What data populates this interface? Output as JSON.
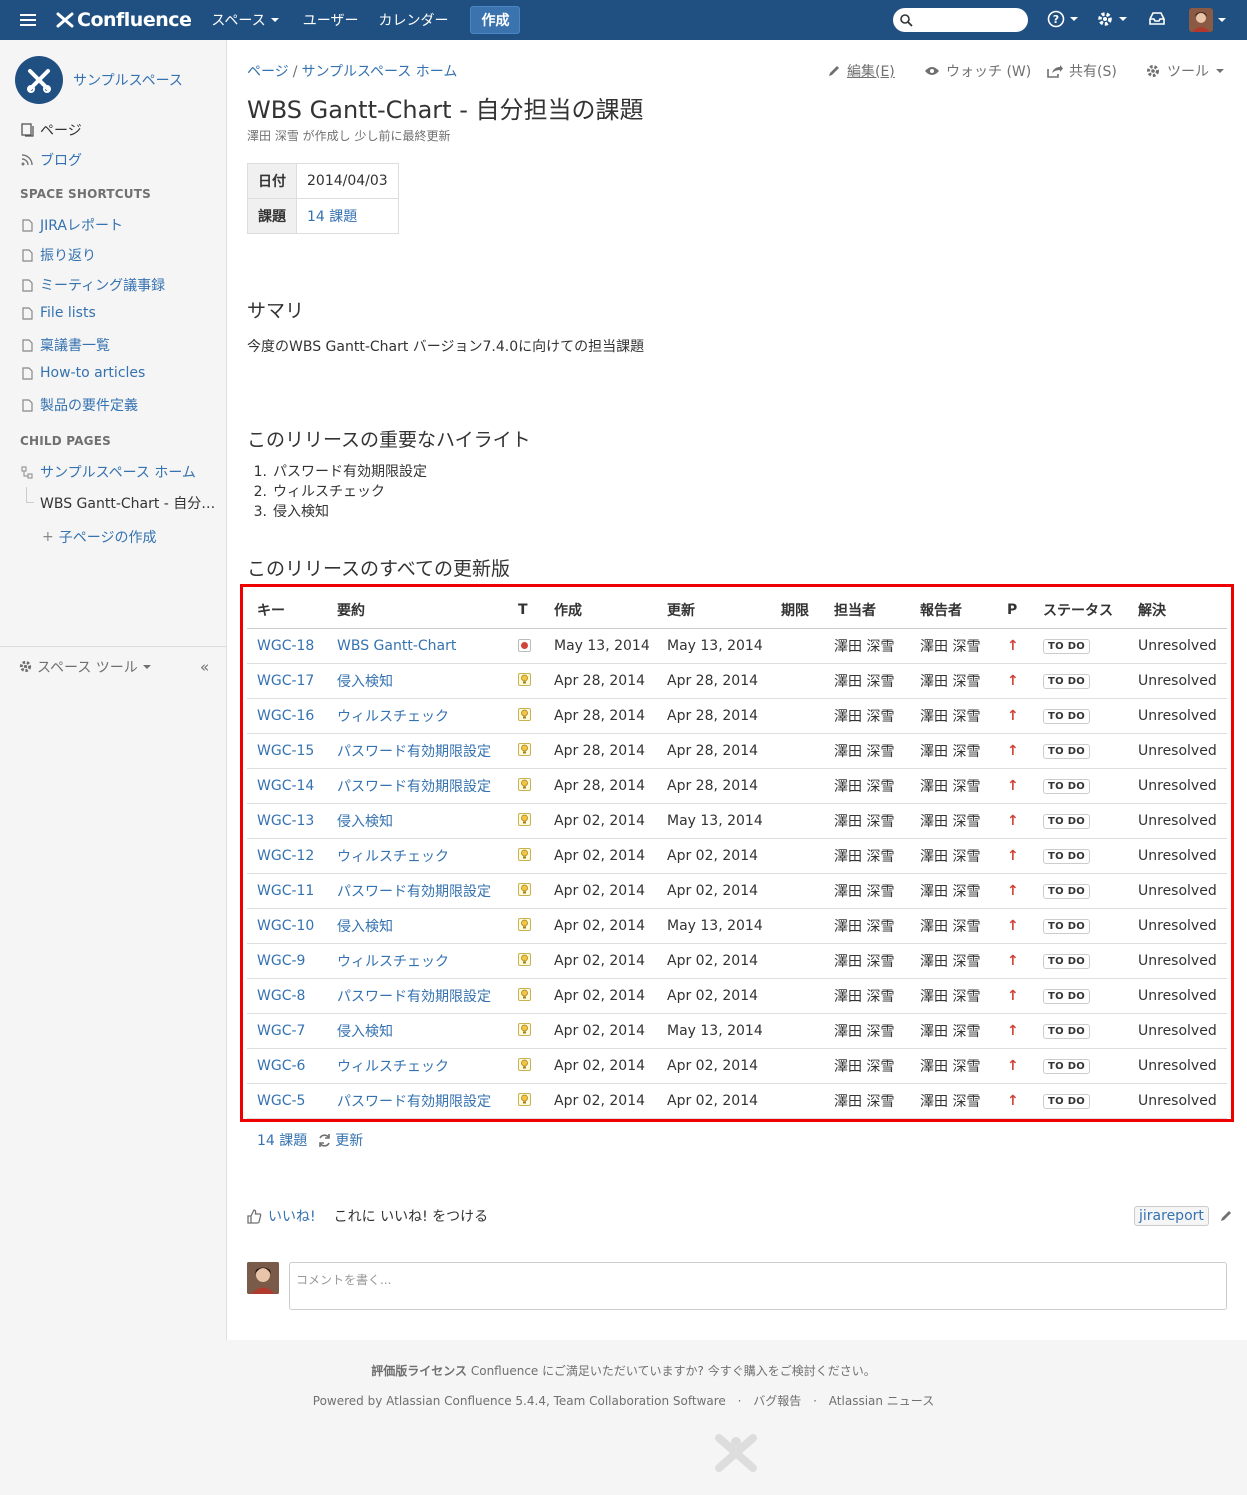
{
  "topnav": {
    "logo_text": "Confluence",
    "spaces": "スペース",
    "users": "ユーザー",
    "calendar": "カレンダー",
    "create": "作成"
  },
  "sidebar": {
    "space_name": "サンプルスペース",
    "pages": "ページ",
    "blog": "ブログ",
    "shortcuts_heading": "SPACE SHORTCUTS",
    "shortcuts": [
      "JIRAレポート",
      "振り返り",
      "ミーティング議事録",
      "File lists",
      "稟議書一覧",
      "How-to articles",
      "製品の要件定義"
    ],
    "child_heading": "CHILD PAGES",
    "child_home": "サンプルスペース ホーム",
    "child_current": "WBS Gantt-Chart - 自分…",
    "create_child": "子ページの作成",
    "space_tools": "スペース ツール"
  },
  "breadcrumb": {
    "pages": "ページ",
    "sep": "/",
    "home": "サンプルスペース ホーム"
  },
  "actions": {
    "edit": "編集(E)",
    "watch": "ウォッチ (W)",
    "share": "共有(S)",
    "tools": "ツール"
  },
  "page": {
    "title": "WBS Gantt-Chart - 自分担当の課題",
    "meta": "澤田 深雪 が作成し 少し前に最終更新"
  },
  "props": {
    "date_label": "日付",
    "date_value": "2014/04/03",
    "issues_label": "課題",
    "issues_value": "14 課題"
  },
  "summary": {
    "heading": "サマリ",
    "text": "今度のWBS Gantt-Chart バージョン7.4.0に向けての担当課題"
  },
  "highlights": {
    "heading": "このリリースの重要なハイライト",
    "items": [
      "パスワード有効期限設定",
      "ウィルスチェック",
      "侵入検知"
    ]
  },
  "all_updates": {
    "heading": "このリリースのすべての更新版"
  },
  "jira": {
    "headers": [
      "キー",
      "要約",
      "T",
      "作成",
      "更新",
      "期限",
      "担当者",
      "報告者",
      "P",
      "ステータス",
      "解決"
    ],
    "rows": [
      {
        "key": "WGC-18",
        "summary": "WBS Gantt-Chart",
        "type": "bug",
        "created": "May 13, 2014",
        "updated": "May 13, 2014",
        "due": "",
        "assignee": "澤田 深雪",
        "reporter": "澤田 深雪",
        "status": "TO DO",
        "resolution": "Unresolved"
      },
      {
        "key": "WGC-17",
        "summary": "侵入検知",
        "type": "improvement",
        "created": "Apr 28, 2014",
        "updated": "Apr 28, 2014",
        "due": "",
        "assignee": "澤田 深雪",
        "reporter": "澤田 深雪",
        "status": "TO DO",
        "resolution": "Unresolved"
      },
      {
        "key": "WGC-16",
        "summary": "ウィルスチェック",
        "type": "improvement",
        "created": "Apr 28, 2014",
        "updated": "Apr 28, 2014",
        "due": "",
        "assignee": "澤田 深雪",
        "reporter": "澤田 深雪",
        "status": "TO DO",
        "resolution": "Unresolved"
      },
      {
        "key": "WGC-15",
        "summary": "パスワード有効期限設定",
        "type": "improvement",
        "created": "Apr 28, 2014",
        "updated": "Apr 28, 2014",
        "due": "",
        "assignee": "澤田 深雪",
        "reporter": "澤田 深雪",
        "status": "TO DO",
        "resolution": "Unresolved"
      },
      {
        "key": "WGC-14",
        "summary": "パスワード有効期限設定",
        "type": "improvement",
        "created": "Apr 28, 2014",
        "updated": "Apr 28, 2014",
        "due": "",
        "assignee": "澤田 深雪",
        "reporter": "澤田 深雪",
        "status": "TO DO",
        "resolution": "Unresolved"
      },
      {
        "key": "WGC-13",
        "summary": "侵入検知",
        "type": "improvement",
        "created": "Apr 02, 2014",
        "updated": "May 13, 2014",
        "due": "",
        "assignee": "澤田 深雪",
        "reporter": "澤田 深雪",
        "status": "TO DO",
        "resolution": "Unresolved"
      },
      {
        "key": "WGC-12",
        "summary": "ウィルスチェック",
        "type": "improvement",
        "created": "Apr 02, 2014",
        "updated": "Apr 02, 2014",
        "due": "",
        "assignee": "澤田 深雪",
        "reporter": "澤田 深雪",
        "status": "TO DO",
        "resolution": "Unresolved"
      },
      {
        "key": "WGC-11",
        "summary": "パスワード有効期限設定",
        "type": "improvement",
        "created": "Apr 02, 2014",
        "updated": "Apr 02, 2014",
        "due": "",
        "assignee": "澤田 深雪",
        "reporter": "澤田 深雪",
        "status": "TO DO",
        "resolution": "Unresolved"
      },
      {
        "key": "WGC-10",
        "summary": "侵入検知",
        "type": "improvement",
        "created": "Apr 02, 2014",
        "updated": "May 13, 2014",
        "due": "",
        "assignee": "澤田 深雪",
        "reporter": "澤田 深雪",
        "status": "TO DO",
        "resolution": "Unresolved"
      },
      {
        "key": "WGC-9",
        "summary": "ウィルスチェック",
        "type": "improvement",
        "created": "Apr 02, 2014",
        "updated": "Apr 02, 2014",
        "due": "",
        "assignee": "澤田 深雪",
        "reporter": "澤田 深雪",
        "status": "TO DO",
        "resolution": "Unresolved"
      },
      {
        "key": "WGC-8",
        "summary": "パスワード有効期限設定",
        "type": "improvement",
        "created": "Apr 02, 2014",
        "updated": "Apr 02, 2014",
        "due": "",
        "assignee": "澤田 深雪",
        "reporter": "澤田 深雪",
        "status": "TO DO",
        "resolution": "Unresolved"
      },
      {
        "key": "WGC-7",
        "summary": "侵入検知",
        "type": "improvement",
        "created": "Apr 02, 2014",
        "updated": "May 13, 2014",
        "due": "",
        "assignee": "澤田 深雪",
        "reporter": "澤田 深雪",
        "status": "TO DO",
        "resolution": "Unresolved"
      },
      {
        "key": "WGC-6",
        "summary": "ウィルスチェック",
        "type": "improvement",
        "created": "Apr 02, 2014",
        "updated": "Apr 02, 2014",
        "due": "",
        "assignee": "澤田 深雪",
        "reporter": "澤田 深雪",
        "status": "TO DO",
        "resolution": "Unresolved"
      },
      {
        "key": "WGC-5",
        "summary": "パスワード有効期限設定",
        "type": "improvement",
        "created": "Apr 02, 2014",
        "updated": "Apr 02, 2014",
        "due": "",
        "assignee": "澤田 深雪",
        "reporter": "澤田 深雪",
        "status": "TO DO",
        "resolution": "Unresolved"
      }
    ],
    "footer_count": "14 課題",
    "refresh": "更新"
  },
  "like": {
    "like": "いいね!",
    "prompt": "これに いいね! をつける"
  },
  "labels": {
    "tag": "jirareport"
  },
  "comment": {
    "placeholder": "コメントを書く..."
  },
  "footer": {
    "eval_bold": "評価版ライセンス",
    "eval_text": " Confluence にご満足いただいていますか? 今すぐ購入をご検討ください。",
    "powered": "Powered by Atlassian Confluence 5.4.4, Team Collaboration Software",
    "dot": "·",
    "bug": "バグ報告",
    "news": "Atlassian ニュース"
  },
  "colors": {
    "header": "#205081",
    "link": "#3572b0",
    "highlight_frame": "#ee0000",
    "priority": "#d04437"
  }
}
